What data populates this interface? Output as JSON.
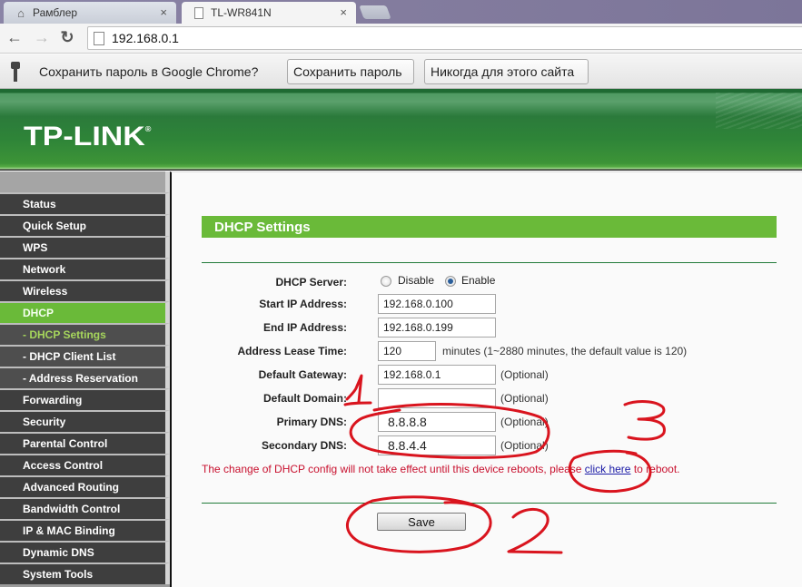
{
  "browser": {
    "tabs": [
      {
        "title": "Рамблер",
        "icon": "home-icon",
        "active": false
      },
      {
        "title": "TL-WR841N",
        "icon": "page-icon",
        "active": true
      }
    ],
    "close_glyph": "×",
    "nav": {
      "back": "←",
      "forward": "→",
      "reload": "↻"
    },
    "url": "192.168.0.1"
  },
  "password_bar": {
    "prompt": "Сохранить пароль в Google Chrome?",
    "save_label": "Сохранить пароль",
    "never_label": "Никогда для этого сайта"
  },
  "banner": {
    "logo": "TP-LINK",
    "registered": "®"
  },
  "sidebar": {
    "items": [
      {
        "label": "Status"
      },
      {
        "label": "Quick Setup"
      },
      {
        "label": "WPS"
      },
      {
        "label": "Network"
      },
      {
        "label": "Wireless"
      },
      {
        "label": "DHCP",
        "active": true
      },
      {
        "label": "- DHCP Settings",
        "sub": true,
        "current": true
      },
      {
        "label": "- DHCP Client List",
        "sub": true
      },
      {
        "label": "- Address Reservation",
        "sub": true
      },
      {
        "label": "Forwarding"
      },
      {
        "label": "Security"
      },
      {
        "label": "Parental Control"
      },
      {
        "label": "Access Control"
      },
      {
        "label": "Advanced Routing"
      },
      {
        "label": "Bandwidth Control"
      },
      {
        "label": "IP & MAC Binding"
      },
      {
        "label": "Dynamic DNS"
      },
      {
        "label": "System Tools"
      }
    ]
  },
  "main": {
    "title": "DHCP Settings",
    "dhcp_server": {
      "label": "DHCP Server:",
      "options": [
        "Disable",
        "Enable"
      ],
      "selected": "Enable"
    },
    "fields": {
      "start_ip": {
        "label": "Start IP Address:",
        "value": "192.168.0.100"
      },
      "end_ip": {
        "label": "End IP Address:",
        "value": "192.168.0.199"
      },
      "lease_time": {
        "label": "Address Lease Time:",
        "value": "120",
        "note": "minutes (1~2880 minutes, the default value is 120)"
      },
      "gateway": {
        "label": "Default Gateway:",
        "value": "192.168.0.1",
        "note": "(Optional)"
      },
      "domain": {
        "label": "Default Domain:",
        "value": "",
        "note": "(Optional)"
      },
      "primary_dns": {
        "label": "Primary DNS:",
        "value": "8.8.8.8",
        "note": "(Optional)"
      },
      "secondary_dns": {
        "label": "Secondary DNS:",
        "value": "8.8.4.4",
        "note": "(Optional)"
      }
    },
    "warning": {
      "before": "The change of DHCP config will not take effect until this device reboots, please ",
      "link": "click here",
      "after": " to reboot."
    },
    "save_label": "Save"
  },
  "annotations": {
    "numbers": [
      "1",
      "2",
      "3"
    ],
    "color": "#d9141e"
  },
  "colors": {
    "accent_green": "#6aba39",
    "sidebar_dark": "#3e3e3e",
    "warning_red": "#c8102e",
    "link_blue": "#1a1aa6"
  }
}
